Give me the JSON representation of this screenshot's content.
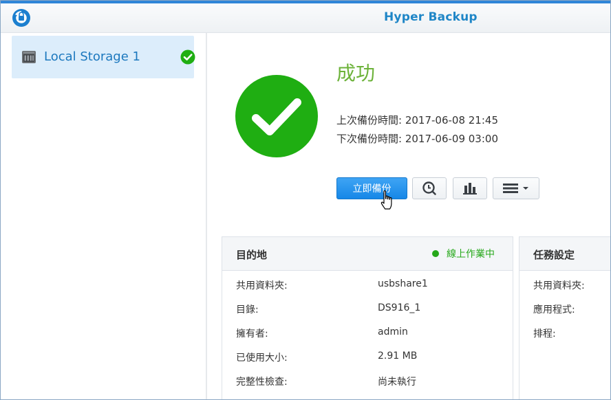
{
  "window": {
    "title": "Hyper Backup"
  },
  "sidebar": {
    "items": [
      {
        "label": "Local Storage 1",
        "status": "success"
      }
    ]
  },
  "status": {
    "title": "成功",
    "last_backup": "上次備份時間: 2017-06-08 21:45",
    "next_backup": "下次備份時間: 2017-06-09 03:00"
  },
  "actions": {
    "backup_now": "立即備份"
  },
  "destination": {
    "title": "目的地",
    "online_status": "線上作業中",
    "rows": [
      {
        "key": "共用資料夾:",
        "value": "usbshare1"
      },
      {
        "key": "目錄:",
        "value": "DS916_1"
      },
      {
        "key": "擁有者:",
        "value": "admin"
      },
      {
        "key": "已使用大小:",
        "value": "2.91 MB"
      },
      {
        "key": "完整性檢查:",
        "value": "尚未執行"
      }
    ]
  },
  "task_settings": {
    "title": "任務設定",
    "rows": [
      {
        "key": "共用資料夾:"
      },
      {
        "key": "應用程式:"
      },
      {
        "key": "排程:"
      }
    ]
  },
  "colors": {
    "accent": "#2f86d8",
    "success": "#1fae12",
    "title_green": "#6cb239",
    "online_green": "#26a81a",
    "primary_button": "#1687e7"
  }
}
